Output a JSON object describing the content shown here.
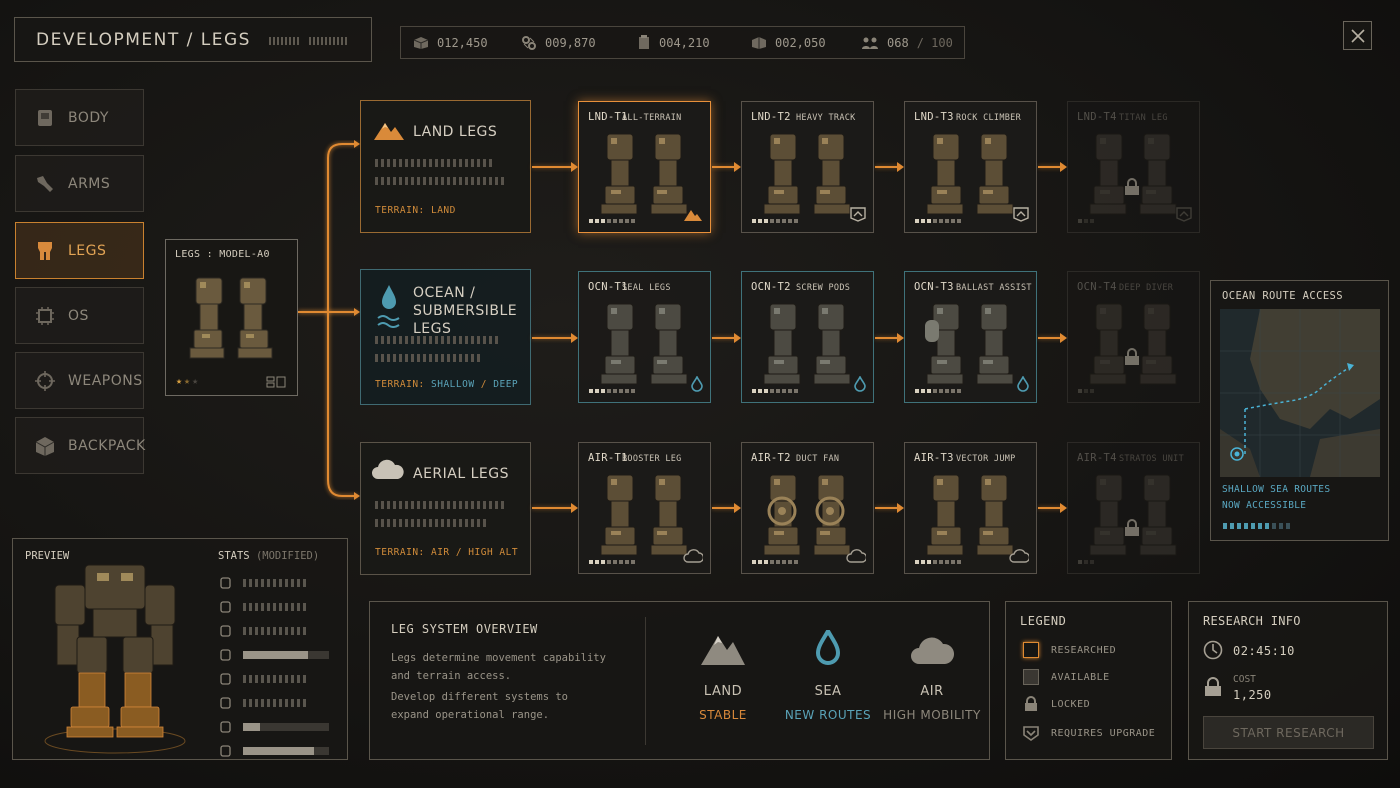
{
  "header": {
    "breadcrumb": "DEVELOPMENT / LEGS",
    "close_icon": "close-icon"
  },
  "resources": [
    {
      "icon": "crate-icon",
      "value": "012,450"
    },
    {
      "icon": "gears-icon",
      "value": "009,870"
    },
    {
      "icon": "canister-icon",
      "value": "004,210"
    },
    {
      "icon": "box-icon",
      "value": "002,050"
    },
    {
      "icon": "crew-icon",
      "value": "068",
      "max": "/ 100"
    }
  ],
  "sidebar": {
    "items": [
      {
        "label": "BODY",
        "icon": "body-icon"
      },
      {
        "label": "ARMS",
        "icon": "arm-icon"
      },
      {
        "label": "LEGS",
        "icon": "legs-icon",
        "active": true
      },
      {
        "label": "OS",
        "icon": "chip-icon"
      },
      {
        "label": "WEAPONS",
        "icon": "crosshair-icon"
      },
      {
        "label": "BACKPACK",
        "icon": "backpack-icon"
      }
    ]
  },
  "base": {
    "title": "LEGS : MODEL-A0",
    "rating": 1.5
  },
  "categories": [
    {
      "title": "LAND LEGS",
      "terrain": "TERRAIN: LAND",
      "icon": "mountain-icon"
    },
    {
      "title_line1": "OCEAN /",
      "title_line2": "SUBMERSIBLE LEGS",
      "terrain_prefix": "TERRAIN:",
      "terrain_a": "SHALLOW",
      "terrain_sep": "/",
      "terrain_b": "DEEP",
      "icon": "water-drop-icon"
    },
    {
      "title": "AERIAL LEGS",
      "terrain": "TERRAIN: AIR / HIGH ALT",
      "icon": "cloud-icon"
    }
  ],
  "tree": {
    "land": [
      {
        "code": "LND-T1",
        "name": "ALL-TERRAIN",
        "state": "researched"
      },
      {
        "code": "LND-T2",
        "name": "HEAVY TRACK",
        "state": "requires-upgrade"
      },
      {
        "code": "LND-T3",
        "name": "ROCK CLIMBER",
        "state": "requires-upgrade"
      },
      {
        "code": "LND-T4",
        "name": "TITAN LEG",
        "state": "locked"
      }
    ],
    "sea": [
      {
        "code": "OCN-T1",
        "name": "SEAL LEGS",
        "state": "available"
      },
      {
        "code": "OCN-T2",
        "name": "SCREW PODS",
        "state": "available"
      },
      {
        "code": "OCN-T3",
        "name": "BALLAST ASSIST",
        "state": "available"
      },
      {
        "code": "OCN-T4",
        "name": "DEEP DIVER",
        "state": "locked"
      }
    ],
    "air": [
      {
        "code": "AIR-T1",
        "name": "BOOSTER LEG",
        "state": "available"
      },
      {
        "code": "AIR-T2",
        "name": "DUCT FAN",
        "state": "available"
      },
      {
        "code": "AIR-T3",
        "name": "VECTOR JUMP",
        "state": "available"
      },
      {
        "code": "AIR-T4",
        "name": "STRATOS UNIT",
        "state": "locked"
      }
    ]
  },
  "ocean_route": {
    "title": "OCEAN ROUTE ACCESS",
    "line1": "SHALLOW SEA ROUTES",
    "line2": "NOW ACCESSIBLE"
  },
  "preview": {
    "title": "PREVIEW",
    "stats_title": "STATS",
    "stats_note": "(MODIFIED)",
    "stats": [
      {
        "icon": "armor-icon",
        "level": 0.0
      },
      {
        "icon": "shield-icon",
        "level": 0.0
      },
      {
        "icon": "grip-icon",
        "level": 0.0
      },
      {
        "icon": "speed-icon",
        "level": 0.75
      },
      {
        "icon": "weight-icon",
        "level": 0.0
      },
      {
        "icon": "balance-icon",
        "level": 0.0
      },
      {
        "icon": "jump-icon",
        "level": 0.2
      },
      {
        "icon": "capacity-icon",
        "level": 0.82
      }
    ]
  },
  "overview": {
    "title": "LEG SYSTEM OVERVIEW",
    "p1": "Legs determine movement capability and terrain access.",
    "p2": "Develop different systems to expand operational range.",
    "modes": [
      {
        "label": "LAND",
        "sub": "STABLE",
        "color": "#d8883a",
        "icon": "mountain-icon"
      },
      {
        "label": "SEA",
        "sub": "NEW ROUTES",
        "color": "#5aa3b8",
        "icon": "water-drop-icon"
      },
      {
        "label": "AIR",
        "sub": "HIGH MOBILITY",
        "color": "#8d877b",
        "icon": "cloud-icon"
      }
    ]
  },
  "legend": {
    "title": "LEGEND",
    "items": [
      "RESEARCHED",
      "AVAILABLE",
      "LOCKED",
      "REQUIRES UPGRADE"
    ]
  },
  "research": {
    "title": "RESEARCH INFO",
    "time": "02:45:10",
    "cost_label": "COST",
    "cost": "1,250",
    "button": "START RESEARCH"
  },
  "colors": {
    "accent": "#e08a32",
    "sea": "#4e9bb0",
    "panel_border": "#4a453d"
  }
}
